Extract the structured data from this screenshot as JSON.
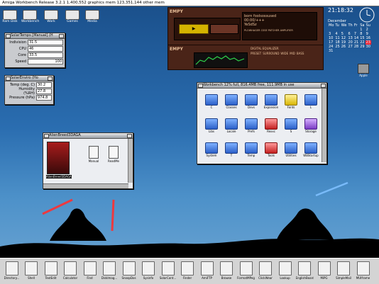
{
  "screen_title": "Amiga Workbench Release 3.2.1   1,400,552 graphics mem  123,351,144 other mem",
  "top_icons": [
    {
      "name": "Ram Disk",
      "icon": "ram-disk-icon"
    },
    {
      "name": "Workbench",
      "icon": "drive-icon"
    },
    {
      "name": "Work",
      "icon": "drive-icon"
    },
    {
      "name": "Games",
      "icon": "drive-icon"
    },
    {
      "name": "Media",
      "icon": "drive-icon"
    }
  ],
  "solar_temps": {
    "title": "SolarTemps [Manual] (H",
    "fields": [
      {
        "label": "Indivision",
        "value": "31.5"
      },
      {
        "label": "CPU",
        "value": "46"
      },
      {
        "label": "Core",
        "value": "33.5"
      },
      {
        "label": "Speed",
        "value": "100"
      }
    ]
  },
  "solar_enviro": {
    "title": "SolarEnviro (Ho",
    "fields": [
      {
        "label": "Temp (deg. C)",
        "value": "30.2"
      },
      {
        "label": "Humidity (%RH)",
        "value": "27.8"
      },
      {
        "label": "Pressure (hPa)",
        "value": "974.8"
      }
    ]
  },
  "player": {
    "brand": "EMPY",
    "track": "born foolsossused",
    "time": "00:00/+++",
    "format": "YeSdSz",
    "mode_text": "PLOWHAGER CSSE PATCHER AMPLIFIER",
    "eq_title": "DIGITAL EQUALIZER",
    "eq_buttons": [
      "PRESET",
      "SURROUND",
      "WIDE",
      "MID",
      "BASS"
    ]
  },
  "calendar": {
    "time": "21:18:32",
    "month": "December",
    "weekdays": [
      "Mo",
      "Tu",
      "We",
      "Th",
      "Fr",
      "Sa",
      "Su"
    ],
    "days": [
      [
        "",
        "",
        "",
        "",
        "",
        "1",
        "2"
      ],
      [
        "3",
        "4",
        "5",
        "6",
        "7",
        "8",
        "9"
      ],
      [
        "10",
        "11",
        "12",
        "13",
        "14",
        "15",
        "16"
      ],
      [
        "17",
        "18",
        "19",
        "20",
        "21",
        "22",
        "23"
      ],
      [
        "24",
        "25",
        "26",
        "27",
        "28",
        "29",
        "30"
      ],
      [
        "31",
        "",
        "",
        "",
        "",
        "",
        ""
      ]
    ],
    "highlight": "23",
    "gadget_label": "Apple"
  },
  "workbench": {
    "title": "Workbench  12% full, 816.4MB free, 111.9MB in use",
    "icons": [
      {
        "label": "C",
        "color": "blue"
      },
      {
        "label": "Classes",
        "color": "blue"
      },
      {
        "label": "Devs",
        "color": "blue"
      },
      {
        "label": "Expansion",
        "color": "blue"
      },
      {
        "label": "Fonts",
        "color": "yellow"
      },
      {
        "label": "L",
        "color": "blue"
      },
      {
        "label": "Libs",
        "color": "blue"
      },
      {
        "label": "Locale",
        "color": "blue"
      },
      {
        "label": "Prefs",
        "color": "blue"
      },
      {
        "label": "Rexxc",
        "color": "red"
      },
      {
        "label": "S",
        "color": "blue"
      },
      {
        "label": "Storage",
        "color": "purple"
      },
      {
        "label": "System",
        "color": "blue"
      },
      {
        "label": "T",
        "color": "blue"
      },
      {
        "label": "Temp",
        "color": "blue"
      },
      {
        "label": "Tools",
        "color": "red"
      },
      {
        "label": "Utilities",
        "color": "blue"
      },
      {
        "label": "WBStartup",
        "color": "blue"
      }
    ]
  },
  "alien_breed": {
    "title": "AlienBreed3DAGA",
    "items": [
      {
        "label": "AlienBreed3DAGA"
      },
      {
        "label": "Manual"
      },
      {
        "label": "ReadMe"
      }
    ]
  },
  "taskbar": [
    {
      "label": "Directory..."
    },
    {
      "label": "Shell"
    },
    {
      "label": "TextEdit"
    },
    {
      "label": "Calculator"
    },
    {
      "label": "Find"
    },
    {
      "label": "DiskImag..."
    },
    {
      "label": "SnoopDos"
    },
    {
      "label": "Sysinfo"
    },
    {
      "label": "SolarCont..."
    },
    {
      "label": "Finder"
    },
    {
      "label": "AmiFTP"
    },
    {
      "label": "Browse"
    },
    {
      "label": "FormatMPeg"
    },
    {
      "label": "ClickWear"
    },
    {
      "label": "Lookup"
    },
    {
      "label": "EnglishBoard"
    },
    {
      "label": "MiPG"
    },
    {
      "label": "SimpleMail"
    },
    {
      "label": "MUIframe"
    }
  ],
  "colors": {
    "accent": "#2a6db0",
    "sky_top": "#1a4f8a",
    "silhouette": "#000000",
    "saber_red": "#ff3030",
    "saber_blue": "#7fc0ff"
  }
}
